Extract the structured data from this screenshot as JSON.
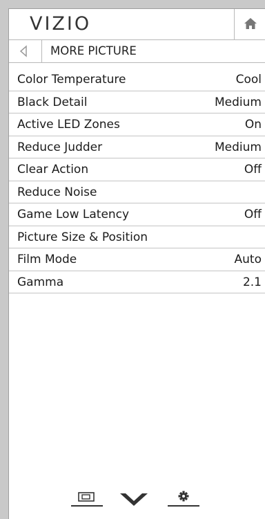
{
  "header": {
    "logo": "VIZIO",
    "home_icon": "home-icon"
  },
  "titlebar": {
    "back_icon": "back-triangle-icon",
    "title": "MORE PICTURE"
  },
  "menu": {
    "items": [
      {
        "label": "Color Temperature",
        "value": "Cool"
      },
      {
        "label": "Black Detail",
        "value": "Medium"
      },
      {
        "label": "Active LED Zones",
        "value": "On"
      },
      {
        "label": "Reduce Judder",
        "value": "Medium"
      },
      {
        "label": "Clear Action",
        "value": "Off"
      },
      {
        "label": "Reduce Noise",
        "value": ""
      },
      {
        "label": "Game Low Latency",
        "value": "Off"
      },
      {
        "label": "Picture Size & Position",
        "value": ""
      },
      {
        "label": "Film Mode",
        "value": "Auto"
      },
      {
        "label": "Gamma",
        "value": "2.1"
      }
    ]
  },
  "bottom_bar": {
    "icons": [
      "input-icon",
      "vizio-v-icon",
      "settings-gear-icon"
    ]
  }
}
